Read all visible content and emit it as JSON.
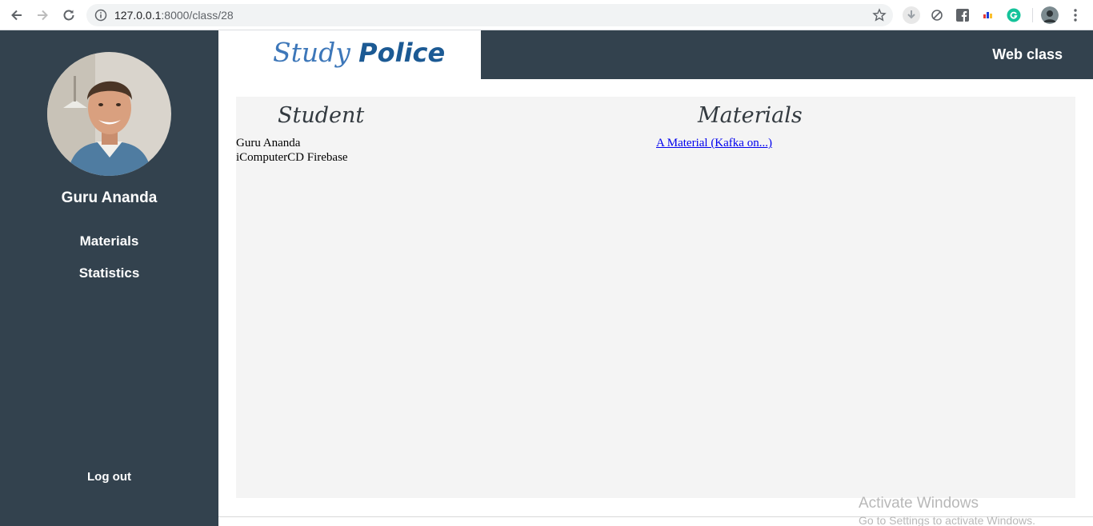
{
  "browser": {
    "url_host": "127.0.0.1",
    "url_path": ":8000/class/28"
  },
  "sidebar": {
    "name": "Guru Ananda",
    "links": [
      "Materials",
      "Statistics"
    ],
    "logout": "Log out"
  },
  "header": {
    "logo_study": "Study",
    "logo_police": "Police",
    "title": "Web class"
  },
  "main": {
    "student_heading": "Student",
    "materials_heading": "Materials",
    "students": [
      "Guru Ananda",
      "iComputerCD Firebase"
    ],
    "materials": [
      "A Material (Kafka on...)"
    ]
  },
  "watermark": {
    "line1": "Activate Windows",
    "line2": "Go to Settings to activate Windows."
  }
}
